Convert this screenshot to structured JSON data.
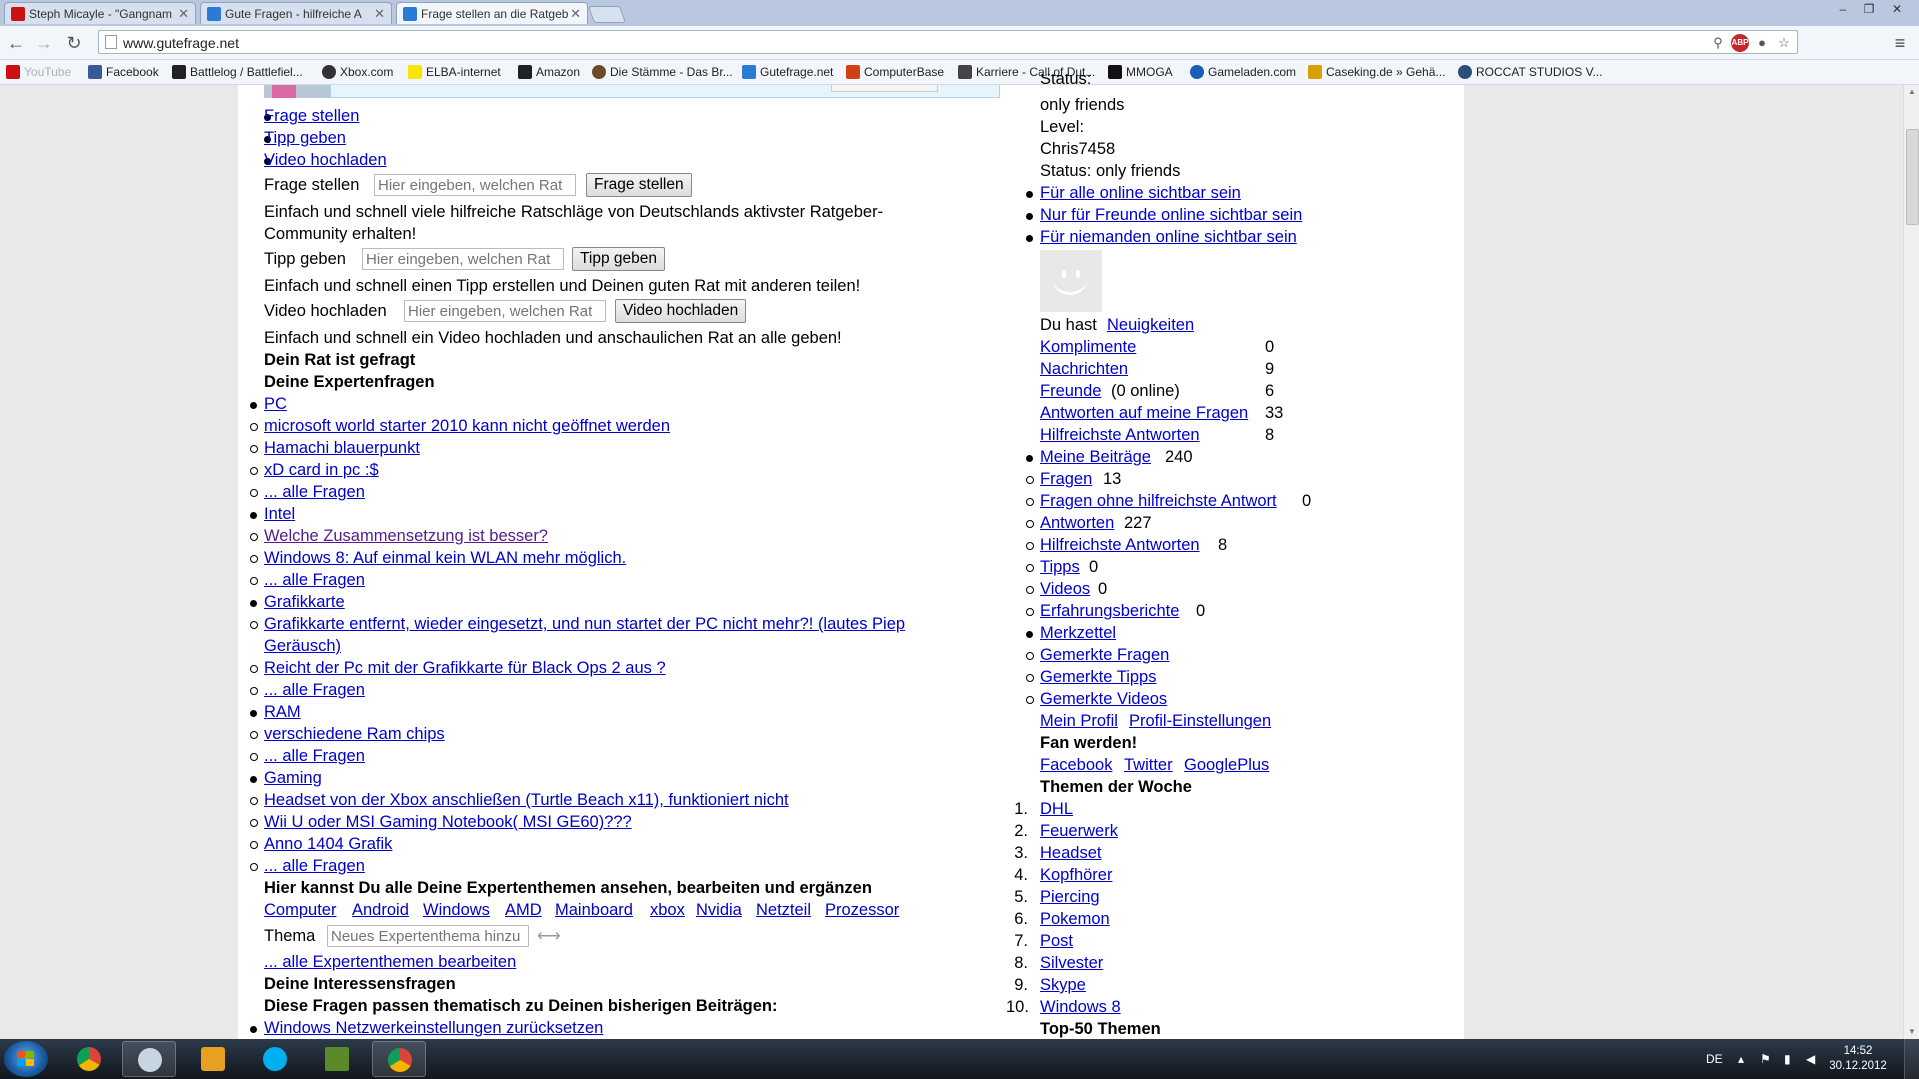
{
  "browser": {
    "tabs": [
      {
        "title": "Steph Micayle - \"Gangnam",
        "icon_color": "#cc1111"
      },
      {
        "title": "Gute Fragen - hilfreiche A",
        "icon_color": "#2a7bd6"
      },
      {
        "title": "Frage stellen an die Ratgeb",
        "icon_color": "#2a7bd6"
      }
    ],
    "window_controls": {
      "minimize": "–",
      "maximize": "❐",
      "close": "✕"
    },
    "url": "www.gutefrage.net",
    "bookmarks": [
      {
        "label": "YouTube",
        "icon_color": "#cc1111"
      },
      {
        "label": "Facebook",
        "icon_color": "#3b5998"
      },
      {
        "label": "Battlelog / Battlefiel...",
        "icon_color": "#222222"
      },
      {
        "label": "Xbox.com",
        "icon_color": "#333333"
      },
      {
        "label": "ELBA-internet",
        "icon_color": "#f5e500"
      },
      {
        "label": "Amazon",
        "icon_color": "#222222"
      },
      {
        "label": "Die Stämme - Das Br...",
        "icon_color": "#6b4a2a"
      },
      {
        "label": "Gutefrage.net",
        "icon_color": "#2a7bd6"
      },
      {
        "label": "ComputerBase",
        "icon_color": "#d04010"
      },
      {
        "label": "Karriere - Call of Dut...",
        "icon_color": "#444444"
      },
      {
        "label": "MMOGA",
        "icon_color": "#111111"
      },
      {
        "label": "Gameladen.com",
        "icon_color": "#1a5fb4"
      },
      {
        "label": "Caseking.de » Gehä...",
        "icon_color": "#d8a000"
      },
      {
        "label": "ROCCAT STUDIOS V...",
        "icon_color": "#2a4f7a"
      }
    ]
  },
  "main": {
    "actions": [
      {
        "label": "Frage stellen"
      },
      {
        "label": "Tipp geben"
      },
      {
        "label": "Video hochladen"
      }
    ],
    "forms": [
      {
        "label": "Frage stellen",
        "placeholder": "Hier eingeben, welchen Rat",
        "button": "Frage stellen",
        "desc1": "Einfach und schnell viele hilfreiche Ratschläge von Deutschlands aktivster Ratgeber-",
        "desc2": "Community erhalten!"
      },
      {
        "label": "Tipp geben",
        "placeholder": "Hier eingeben, welchen Rat",
        "button": "Tipp geben",
        "desc1": "Einfach und schnell einen Tipp erstellen und Deinen guten Rat mit anderen teilen!"
      },
      {
        "label": "Video hochladen",
        "placeholder": "Hier eingeben, welchen Rat",
        "button": "Video hochladen",
        "desc1": "Einfach und schnell ein Video hochladen und anschaulichen Rat an alle geben!"
      }
    ],
    "heading_rat": "Dein Rat ist gefragt",
    "heading_expert": "Deine Expertenfragen",
    "topics": [
      {
        "name": "PC",
        "questions": [
          "microsoft world starter 2010 kann nicht geöffnet werden",
          "Hamachi blauerpunkt",
          "xD card in pc :$"
        ],
        "all": "... alle Fragen"
      },
      {
        "name": "Intel",
        "questions": [
          "Welche Zusammensetzung ist besser?",
          "Windows 8: Auf einmal kein WLAN mehr möglich."
        ],
        "all": "... alle Fragen"
      },
      {
        "name": "Grafikkarte",
        "questions": [
          "Grafikkarte entfernt, wieder eingesetzt, und nun startet der PC nicht mehr?! (lautes Piep",
          "Geräusch)",
          "Reicht der Pc mit der Grafikkarte für Black Ops 2 aus ?"
        ],
        "all": "... alle Fragen"
      },
      {
        "name": "RAM",
        "questions": [
          "verschiedene Ram chips"
        ],
        "all": "... alle Fragen"
      },
      {
        "name": "Gaming",
        "questions": [
          "Headset von der Xbox anschließen (Turtle Beach x11), funktioniert nicht",
          "Wii U oder MSI Gaming Notebook( MSI GE60)???",
          "Anno 1404 Grafik"
        ],
        "all": "... alle Fragen"
      }
    ],
    "expert_heading": "Hier kannst Du alle Deine Expertenthemen ansehen, bearbeiten und ergänzen",
    "expert_tags": [
      "Computer",
      "Android",
      "Windows",
      "AMD",
      "Mainboard",
      "xbox",
      "Nvidia",
      "Netzteil",
      "Prozessor"
    ],
    "thema_label": "Thema",
    "thema_placeholder": "Neues Expertenthema hinzu",
    "thema_arrow": "⟷",
    "edit_topics": "... alle Expertenthemen bearbeiten",
    "interest_heading": "Deine Interessensfragen",
    "interest_sub": "Diese Fragen passen thematisch zu Deinen bisherigen Beiträgen:",
    "interest_q1": "Windows Netzwerkeinstellungen zurücksetzen"
  },
  "side": {
    "status_top": "Status:",
    "status1": "only friends",
    "level": "Level:",
    "user": "Chris7458",
    "status2": "Status: only friends",
    "visibility": [
      "Für alle online sichtbar sein",
      "Nur für Freunde online sichtbar sein",
      "Für niemanden online sichtbar sein"
    ],
    "du_hast": "Du hast",
    "neuigkeiten": "Neuigkeiten",
    "news": [
      {
        "label": "Komplimente",
        "count": "0"
      },
      {
        "label": "Nachrichten",
        "count": "9"
      },
      {
        "label": "Freunde",
        "extra": "(0 online)",
        "count": "6"
      },
      {
        "label": "Antworten auf meine Fragen",
        "count": "33"
      },
      {
        "label": "Hilfreichste Antworten",
        "count": "8"
      }
    ],
    "beitraege": {
      "label": "Meine Beiträge",
      "count": "240"
    },
    "beitraege_items": [
      {
        "label": "Fragen",
        "count": "13"
      },
      {
        "label": "Fragen ohne hilfreichste Antwort",
        "count": "0"
      },
      {
        "label": "Antworten",
        "count": "227"
      },
      {
        "label": "Hilfreichste Antworten",
        "count": "8"
      },
      {
        "label": "Tipps",
        "count": "0"
      },
      {
        "label": "Videos",
        "count": "0"
      },
      {
        "label": "Erfahrungsberichte",
        "count": "0"
      }
    ],
    "merkzettel": "Merkzettel",
    "merk_items": [
      "Gemerkte Fragen",
      "Gemerkte Tipps",
      "Gemerkte Videos"
    ],
    "profil": "Mein Profil",
    "profil_settings": "Profil-Einstellungen",
    "fan_heading": "Fan werden!",
    "fan_links": [
      "Facebook",
      "Twitter",
      "GooglePlus"
    ],
    "themen_heading": "Themen der Woche",
    "themen": [
      "DHL",
      "Feuerwerk",
      "Headset",
      "Kopfhörer",
      "Piercing",
      "Pokemon",
      "Post",
      "Silvester",
      "Skype",
      "Windows 8"
    ],
    "top50": "Top-50 Themen"
  },
  "taskbar": {
    "lang": "DE",
    "time": "14:52",
    "date": "30.12.2012"
  }
}
